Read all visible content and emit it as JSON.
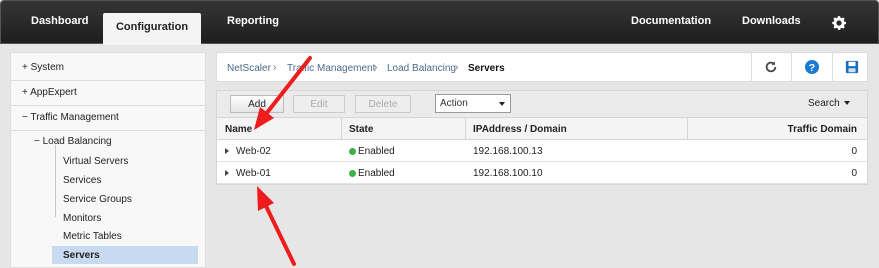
{
  "topbar": {
    "tabs": [
      "Dashboard",
      "Configuration",
      "Reporting"
    ],
    "links": [
      "Documentation",
      "Downloads"
    ],
    "settings_icon": "gear-icon"
  },
  "sidebar": {
    "items": [
      {
        "label": "System",
        "prefix": "+"
      },
      {
        "label": "AppExpert",
        "prefix": "+"
      },
      {
        "label": "Traffic Management",
        "prefix": "−"
      },
      {
        "label": "Load Balancing",
        "prefix": "−"
      },
      {
        "label": "Virtual Servers",
        "prefix": ""
      },
      {
        "label": "Services",
        "prefix": ""
      },
      {
        "label": "Service Groups",
        "prefix": ""
      },
      {
        "label": "Monitors",
        "prefix": ""
      },
      {
        "label": "Metric Tables",
        "prefix": ""
      },
      {
        "label": "Servers",
        "prefix": ""
      }
    ]
  },
  "breadcrumb": [
    "NetScaler",
    "Traffic Management",
    "Load Balancing",
    "Servers"
  ],
  "breadcrumb_icons": [
    "refresh-icon",
    "help-icon",
    "save-icon"
  ],
  "toolbar": {
    "add": "Add",
    "edit": "Edit",
    "delete": "Delete",
    "action": "Action",
    "search": "Search"
  },
  "grid": {
    "columns": [
      "Name",
      "State",
      "IPAddress / Domain",
      "Traffic Domain"
    ],
    "rows": [
      {
        "name": "Web-02",
        "state": "Enabled",
        "ip": "192.168.100.13",
        "td": "0"
      },
      {
        "name": "Web-01",
        "state": "Enabled",
        "ip": "192.168.100.10",
        "td": "0"
      }
    ]
  },
  "colors": {
    "accent_blue": "#1a7bd2",
    "enabled_green": "#3cb043",
    "arrow_red": "#ee1c1c",
    "selection": "#c7daf0"
  }
}
